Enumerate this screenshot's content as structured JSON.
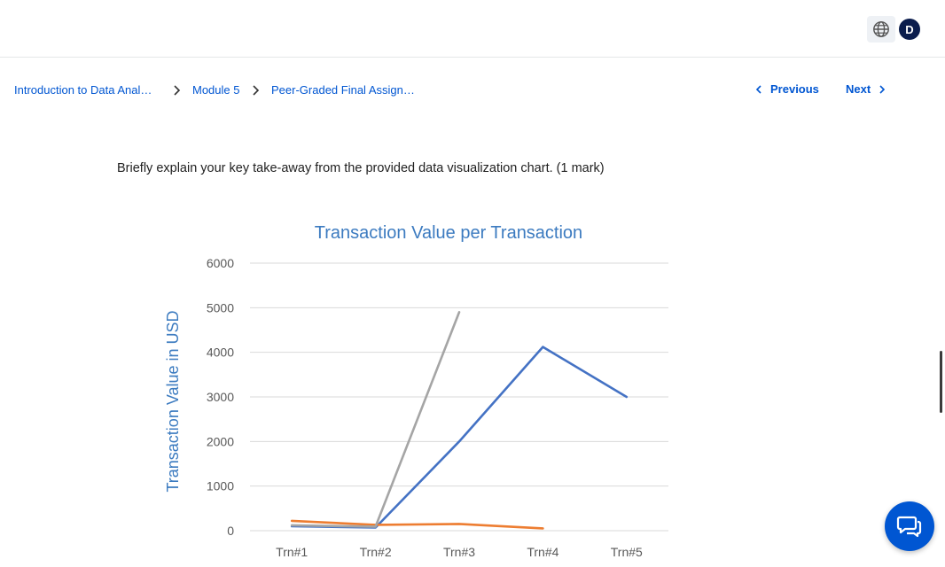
{
  "header": {
    "language_icon": "globe-icon",
    "avatar_initial": "D"
  },
  "breadcrumb": {
    "items": [
      {
        "label": "Introduction to Data Anal…"
      },
      {
        "label": "Module 5"
      },
      {
        "label": "Peer-Graded Final Assign…"
      }
    ],
    "separator_icon": "chevron-right-icon"
  },
  "nav": {
    "previous_label": "Previous",
    "next_label": "Next"
  },
  "question": {
    "text": "Briefly explain your key take-away from the provided data visualization chart. (1 mark)"
  },
  "chart_data": {
    "type": "line",
    "title": "Transaction Value per Transaction",
    "xlabel": "",
    "ylabel": "Transaction Value in USD",
    "categories": [
      "Trn#1",
      "Trn#2",
      "Trn#3",
      "Trn#4",
      "Trn#5"
    ],
    "ylim": [
      0,
      6000
    ],
    "yticks": [
      "0",
      "1000",
      "2000",
      "3000",
      "4000",
      "5000",
      "6000"
    ],
    "grid": true,
    "colors": {
      "title": "#3c7bc0",
      "ylabel": "#3c7bc0",
      "grid": "#d9d9d9",
      "ticks": "#595959"
    },
    "series": [
      {
        "color": "#4472c4",
        "values": [
          100,
          70,
          2000,
          4120,
          3000
        ]
      },
      {
        "color": "#ed7d31",
        "values": [
          220,
          130,
          150,
          50,
          null
        ]
      },
      {
        "color": "#a5a5a5",
        "values": [
          120,
          90,
          4900,
          null,
          null
        ]
      }
    ]
  },
  "chat": {
    "icon": "chat-icon"
  },
  "colors": {
    "link": "#0056d2",
    "avatar_bg": "#0b1d4d",
    "chat_bg": "#0056d2"
  }
}
